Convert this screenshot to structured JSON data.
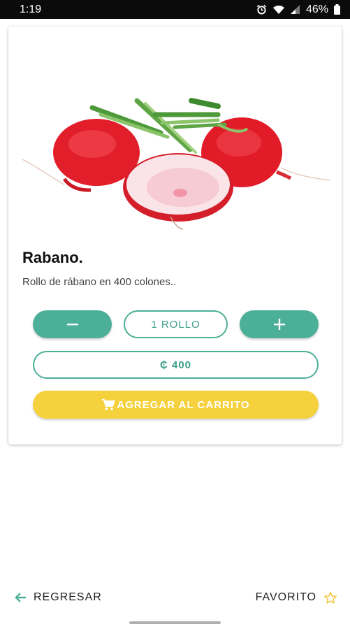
{
  "status_bar": {
    "time": "1:19",
    "battery": "46%",
    "icons": [
      "alarm-icon",
      "wifi-icon",
      "signal-icon",
      "battery-icon"
    ]
  },
  "product": {
    "image": "radish-image",
    "title": "Rabano.",
    "description": "Rollo de rábano en 400 colones.."
  },
  "controls": {
    "minus_icon": "minus-icon",
    "quantity": "1 ROLLO",
    "plus_icon": "plus-icon",
    "price": "₵ 400",
    "add_to_cart": "AGREGAR AL CARRITO",
    "cart_icon": "cart-icon"
  },
  "bottom_nav": {
    "back_label": "REGRESAR",
    "back_icon": "arrow-left-icon",
    "favorite_label": "FAVORITO",
    "favorite_icon": "star-outline-icon"
  },
  "colors": {
    "accent": "#4caf98",
    "cart_button": "#f5d13e",
    "status_bar": "#0b0b0b"
  }
}
